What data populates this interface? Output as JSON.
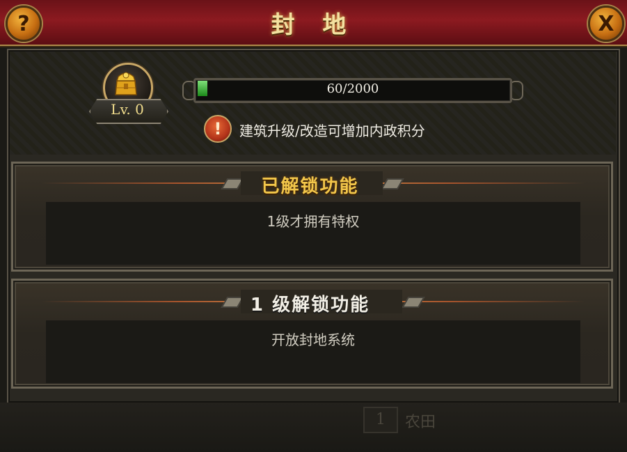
{
  "header": {
    "title": "封 地",
    "help_icon_glyph": "?",
    "close_icon_glyph": "X"
  },
  "level": {
    "label": "Lv. 0",
    "icon": "gold-chest-icon"
  },
  "progress": {
    "text": "60/2000",
    "current": 60,
    "max": 2000
  },
  "hint": {
    "icon_glyph": "!",
    "text": "建筑升级/改造可增加内政积分"
  },
  "panels": [
    {
      "title": "已解锁功能",
      "body": "1级才拥有特权"
    },
    {
      "title": "1 级解锁功能",
      "body": "开放封地系统"
    }
  ],
  "bottom": {
    "number": "1",
    "label": "农田"
  },
  "colors": {
    "title_bar": "#8c1a20",
    "gold_text": "#f2c64a",
    "progress_fill": "#3fb03a"
  }
}
